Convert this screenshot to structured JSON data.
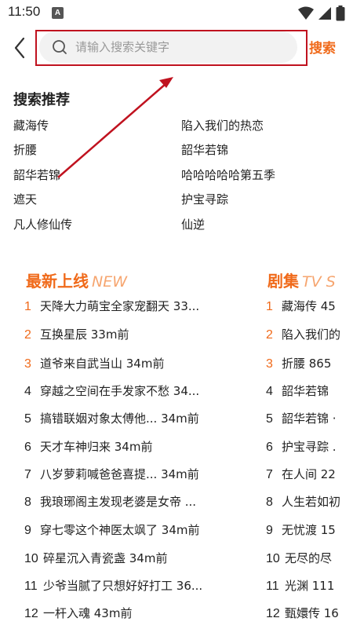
{
  "status": {
    "time": "11:50",
    "notif_letter": "A"
  },
  "header": {
    "placeholder": "请输入搜索关键字",
    "search_label": "搜索"
  },
  "recommend": {
    "title": "搜索推荐",
    "items": [
      "藏海传",
      "陷入我们的热恋",
      "折腰",
      "韶华若锦",
      "韶华若锦",
      "哈哈哈哈哈第五季",
      "遮天",
      "护宝寻踪",
      "凡人修仙传",
      "仙逆"
    ]
  },
  "latest": {
    "title_zh": "最新上线",
    "title_en": "NEW",
    "items": [
      {
        "rank": "1",
        "text": "天降大力萌宝全家宠翻天 33..."
      },
      {
        "rank": "2",
        "text": "互换星辰 33m前"
      },
      {
        "rank": "3",
        "text": "道爷来自武当山 34m前"
      },
      {
        "rank": "4",
        "text": "穿越之空间在手发家不愁 34..."
      },
      {
        "rank": "5",
        "text": "搞错联姻对象太傅他... 34m前"
      },
      {
        "rank": "6",
        "text": "天才车神归来 34m前"
      },
      {
        "rank": "7",
        "text": "八岁萝莉喊爸爸喜提... 34m前"
      },
      {
        "rank": "8",
        "text": "我琅琊阁主发现老婆是女帝 ..."
      },
      {
        "rank": "9",
        "text": "穿七零这个神医太飒了 34m前"
      },
      {
        "rank": "10",
        "text": "碎星沉入青瓷盏 34m前"
      },
      {
        "rank": "11",
        "text": "少爷当腻了只想好好打工 36..."
      },
      {
        "rank": "12",
        "text": "一杆入魂 43m前"
      }
    ]
  },
  "drama": {
    "title_zh": "剧集",
    "title_en": "TV S",
    "items": [
      {
        "rank": "1",
        "text": "藏海传 45"
      },
      {
        "rank": "2",
        "text": "陷入我们的"
      },
      {
        "rank": "3",
        "text": "折腰 865"
      },
      {
        "rank": "4",
        "text": "韶华若锦"
      },
      {
        "rank": "5",
        "text": "韶华若锦 ·"
      },
      {
        "rank": "6",
        "text": "护宝寻踪 ."
      },
      {
        "rank": "7",
        "text": "在人间 22"
      },
      {
        "rank": "8",
        "text": "人生若如初"
      },
      {
        "rank": "9",
        "text": "无忧渡 15"
      },
      {
        "rank": "10",
        "text": "无尽的尽"
      },
      {
        "rank": "11",
        "text": "光渊 111"
      },
      {
        "rank": "12",
        "text": "甄嬛传 16"
      }
    ]
  },
  "colors": {
    "accent": "#f06a1a",
    "accent_light": "#f6a56f",
    "annotation": "#c0121f"
  }
}
